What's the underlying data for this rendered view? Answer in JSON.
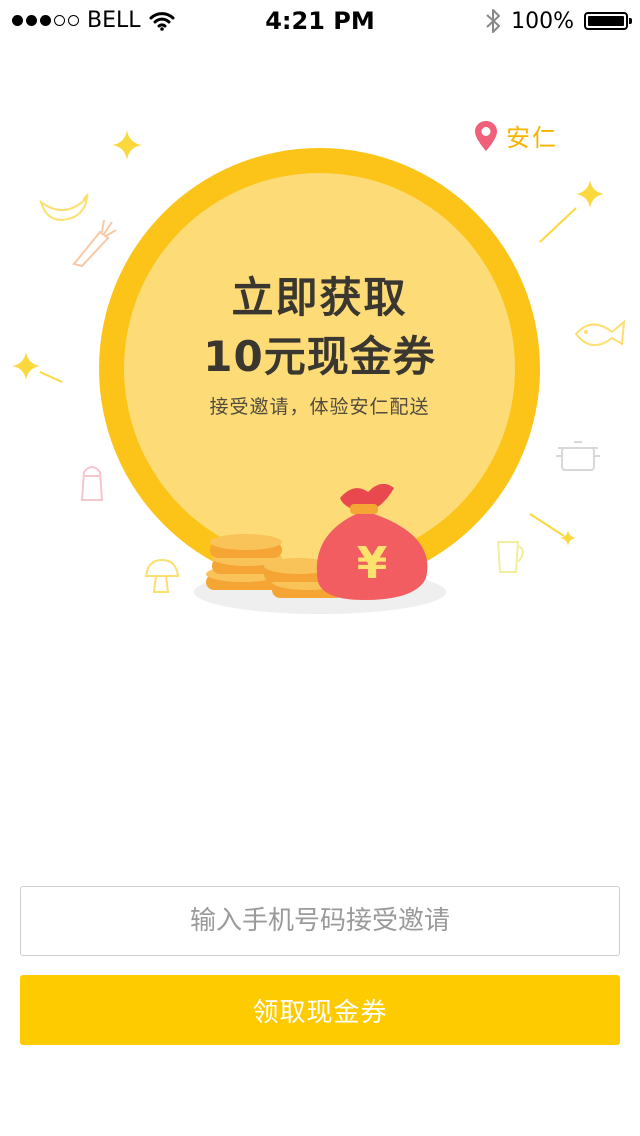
{
  "status_bar": {
    "carrier": "BELL",
    "time": "4:21 PM",
    "battery": "100%",
    "signal_bars_filled": 3,
    "signal_bars_total": 5
  },
  "location": {
    "icon": "location-pin-icon",
    "label": "安仁",
    "color": "#f0607a"
  },
  "hero": {
    "title_line1": "立即获取",
    "title_line2": "10元现金券",
    "subtitle": "接受邀请，体验安仁配送",
    "colors": {
      "ring": "#fcc418",
      "inner": "#fddc78",
      "bag": "#f25d61",
      "coin": "#f4a533"
    },
    "bag_symbol": "¥"
  },
  "form": {
    "phone_placeholder": "输入手机号码接受邀请",
    "phone_value": "",
    "submit_label": "领取现金券",
    "accent": "#fecb00"
  }
}
